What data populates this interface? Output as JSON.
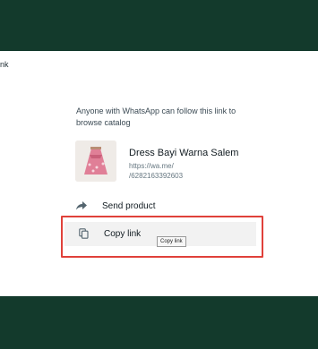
{
  "colors": {
    "band": "#133a2c",
    "highlight": "#e0413a"
  },
  "edge_label": "nk",
  "share": {
    "info_text": "Anyone with WhatsApp can follow this link to browse catalog",
    "product": {
      "name": "Dress Bayi Warna Salem",
      "link_line1": "https://wa.me/",
      "link_line2": "/6282163392603",
      "thumb_icon": "pink-dress-image"
    },
    "actions": [
      {
        "label": "Send product",
        "icon": "share-arrow-icon"
      },
      {
        "label": "Copy link",
        "icon": "copy-icon"
      }
    ],
    "tooltip": "Copy link"
  }
}
